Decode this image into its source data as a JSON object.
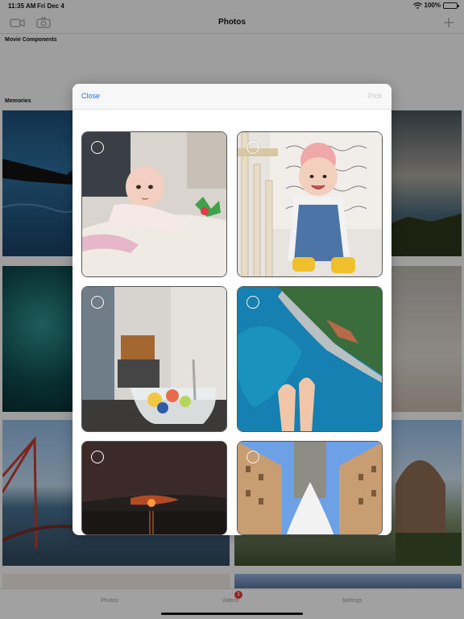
{
  "status": {
    "time": "11:35 AM",
    "date": "Fri Dec 4",
    "battery": "100%",
    "wifi_icon": "wifi-icon",
    "battery_icon": "battery-icon"
  },
  "navbar": {
    "title": "Photos",
    "left_icons": [
      "video-camera-icon",
      "camera-icon"
    ],
    "right_icon": "plus-icon"
  },
  "sections": {
    "movie_components": "Movie Components",
    "memories": "Memories"
  },
  "tabs": [
    {
      "label": "Photos",
      "icon": "photos-tab-icon"
    },
    {
      "label": "Videos",
      "icon": "videos-tab-icon",
      "badge": "1"
    },
    {
      "label": "Settings",
      "icon": "settings-tab-icon"
    }
  ],
  "picker": {
    "close_label": "Close",
    "pick_label": "Pick",
    "photos": [
      {
        "name": "baby-on-blanket-photo",
        "selected": false
      },
      {
        "name": "baby-in-crib-photo",
        "selected": false
      },
      {
        "name": "tea-and-fruit-photo",
        "selected": false
      },
      {
        "name": "coastline-aerial-photo",
        "selected": false
      },
      {
        "name": "sunset-over-water-photo",
        "selected": false
      },
      {
        "name": "building-and-statue-photo",
        "selected": false
      }
    ]
  },
  "colors": {
    "accent": "#1a73e8",
    "badge": "#e53935",
    "disabled": "#c9c9c9"
  }
}
